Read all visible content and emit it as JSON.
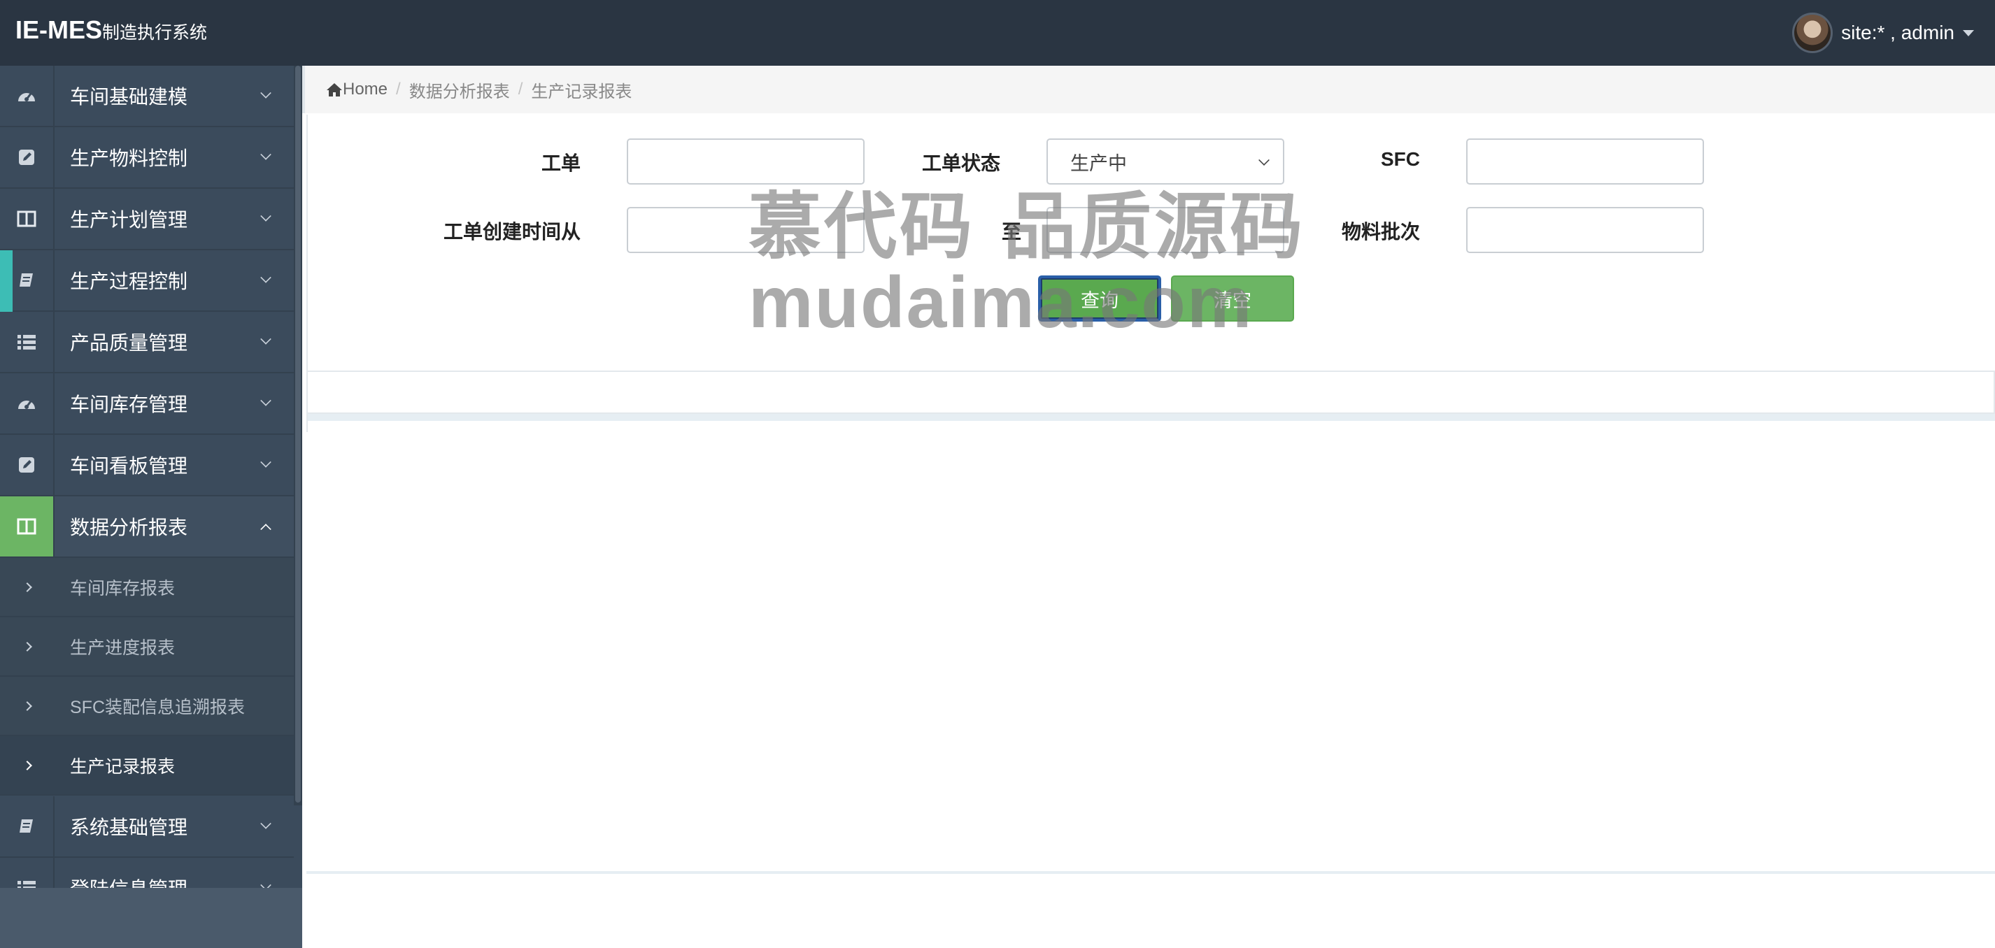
{
  "header": {
    "brand_main": "IE-MES",
    "brand_sub": "制造执行系统",
    "user_label": "site:* , admin"
  },
  "sidebar": {
    "items": [
      {
        "label": "车间基础建模",
        "icon": "dashboard-icon"
      },
      {
        "label": "生产物料控制",
        "icon": "edit-icon"
      },
      {
        "label": "生产计划管理",
        "icon": "columns-icon"
      },
      {
        "label": "生产过程控制",
        "icon": "book-icon"
      },
      {
        "label": "产品质量管理",
        "icon": "list-icon"
      },
      {
        "label": "车间库存管理",
        "icon": "dashboard-icon"
      },
      {
        "label": "车间看板管理",
        "icon": "edit-icon"
      },
      {
        "label": "数据分析报表",
        "icon": "columns-icon"
      }
    ],
    "sub_items": [
      {
        "label": "车间库存报表"
      },
      {
        "label": "生产进度报表"
      },
      {
        "label": "SFC装配信息追溯报表"
      },
      {
        "label": "生产记录报表"
      }
    ],
    "after_items": [
      {
        "label": "系统基础管理",
        "icon": "book-icon"
      },
      {
        "label": "登陆信息管理",
        "icon": "list-icon"
      }
    ],
    "accent_color": "#3dbdb5",
    "active_color": "#6cb564"
  },
  "breadcrumb": {
    "home": "Home",
    "level1": "数据分析报表",
    "level2": "生产记录报表"
  },
  "form": {
    "work_order_label": "工单",
    "work_order_value": "",
    "status_label": "工单状态",
    "status_value": "生产中",
    "sfc_label": "SFC",
    "sfc_value": "",
    "created_from_label": "工单创建时间从",
    "created_from_value": "",
    "to_label": "至",
    "to_value": "",
    "material_batch_label": "物料批次",
    "material_batch_value": "",
    "query_button": "查询",
    "clear_button": "清空"
  },
  "watermark": {
    "line1": "慕代码 品质源码",
    "line2": "mudaima.com"
  }
}
